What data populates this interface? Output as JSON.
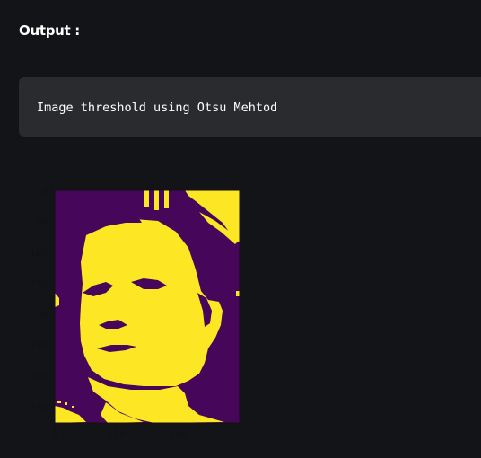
{
  "heading": {
    "label": "Output :"
  },
  "code_block": {
    "text": "Image threshold using Otsu Mehtod"
  },
  "plot": {
    "colors": {
      "background": "#46065a",
      "foreground": "#fde724",
      "axis": "#111111"
    },
    "y_ticks": [
      "0",
      "50",
      "100",
      "150",
      "200",
      "250",
      "300",
      "350"
    ],
    "x_ticks": [
      "0",
      "100",
      "200"
    ]
  }
}
